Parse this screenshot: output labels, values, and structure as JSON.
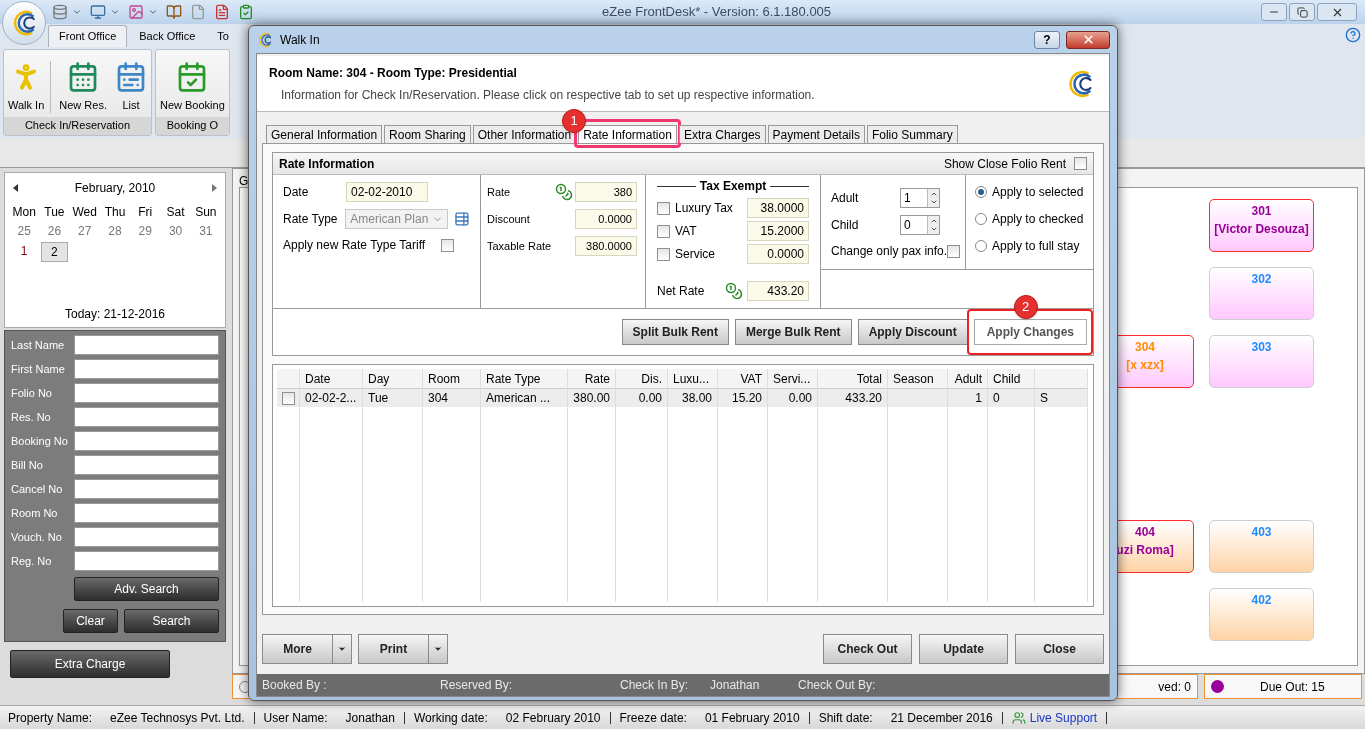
{
  "app": {
    "title": "eZee FrontDesk* - Version: 6.1.180.005"
  },
  "ribbon_tabs": [
    {
      "label": "Front Office",
      "selected": true
    },
    {
      "label": "Back Office",
      "selected": false
    },
    {
      "label": "To",
      "selected": false
    }
  ],
  "ribbon_groups": [
    {
      "label": "Check In/Reservation",
      "buttons": [
        {
          "label": "Walk In",
          "kind": "walkin"
        },
        {
          "label": "New Res.",
          "kind": "calendar"
        },
        {
          "label": "List",
          "kind": "list"
        }
      ]
    },
    {
      "label": "Booking O",
      "buttons": [
        {
          "label": "New Booking",
          "kind": "booking"
        }
      ]
    }
  ],
  "calendar": {
    "month": "February, 2010",
    "weekdays": [
      "Mon",
      "Tue",
      "Wed",
      "Thu",
      "Fri",
      "Sat",
      "Sun"
    ],
    "days": [
      {
        "label": "25",
        "muted": true,
        "selected": false
      },
      {
        "label": "26",
        "muted": true,
        "selected": false
      },
      {
        "label": "27",
        "muted": true,
        "selected": false
      },
      {
        "label": "28",
        "muted": true,
        "selected": false
      },
      {
        "label": "29",
        "muted": true,
        "selected": false
      },
      {
        "label": "30",
        "muted": true,
        "selected": false
      },
      {
        "label": "31",
        "muted": true,
        "selected": false
      },
      {
        "label": "1",
        "muted": false,
        "selected": false
      },
      {
        "label": "2",
        "muted": false,
        "selected": true
      }
    ],
    "today": "Today: 21-12-2016"
  },
  "search": {
    "fields": [
      "Last Name",
      "First Name",
      "Folio No",
      "Res. No",
      "Booking No",
      "Bill No",
      "Cancel No",
      "Room No",
      "Vouch. No",
      "Reg. No"
    ],
    "advanced": "Adv. Search",
    "clear": "Clear",
    "submit": "Search"
  },
  "extra_charge": "Extra Charge",
  "main_tab": "G",
  "room_columns": [
    {
      "floors": [
        {
          "rooms": [
            {
              "number": "304",
              "guest": "[x xzx]",
              "kind": "arrival"
            }
          ]
        },
        {
          "rooms": [
            {
              "number": "404",
              "guest": "uzi Roma]",
              "kind": "occupied"
            }
          ]
        }
      ]
    },
    {
      "floors": [
        {
          "rooms": [
            {
              "number": "301",
              "guest": "[Victor Desouza]",
              "kind": "occupied"
            },
            {
              "number": "302",
              "kind": "vacant"
            },
            {
              "number": "303",
              "kind": "vacant"
            }
          ]
        },
        {
          "rooms": [
            {
              "number": "403",
              "kind": "vacant"
            },
            {
              "number": "402",
              "kind": "vacant"
            }
          ]
        }
      ]
    }
  ],
  "legend": [
    {
      "label": "ved: 0"
    },
    {
      "label": "Due Out: 15",
      "color": "#990099"
    }
  ],
  "status_bar": {
    "items": [
      {
        "label": "Property Name:",
        "value": "eZee Technosys Pvt. Ltd."
      },
      {
        "label": "User Name:",
        "value": "Jonathan"
      },
      {
        "label": "Working date:",
        "value": "02 February 2010"
      },
      {
        "label": "Freeze date:",
        "value": "01 February 2010"
      },
      {
        "label": "Shift date:",
        "value": "21 December 2016"
      }
    ],
    "support": "Live Support"
  },
  "dialog": {
    "title": "Walk In",
    "help": "?",
    "room_heading": "Room Name: 304 - Room Type: Presidential",
    "hint": "Information for Check In/Reservation. Please click on respective tab to set up respective information.",
    "tabs": [
      {
        "label": "General Information",
        "selected": false
      },
      {
        "label": "Room Sharing",
        "selected": false
      },
      {
        "label": "Other Information",
        "selected": false
      },
      {
        "label": "Rate Information",
        "selected": true,
        "callout": "1"
      },
      {
        "label": "Extra Charges",
        "selected": false
      },
      {
        "label": "Payment Details",
        "selected": false
      },
      {
        "label": "Folio Summary",
        "selected": false
      }
    ],
    "section_title": "Rate Information",
    "show_close_folio": {
      "label": "Show Close Folio Rent",
      "checked": false
    },
    "date": {
      "label": "Date",
      "value": "02-02-2010"
    },
    "rate_type": {
      "label": "Rate Type",
      "value": "American Plan",
      "disabled": true
    },
    "apply_tariff": {
      "label": "Apply new Rate Type Tariff",
      "checked": false
    },
    "amounts": [
      {
        "label": "Rate",
        "value": "380",
        "kind": "currency"
      },
      {
        "label": "Discount",
        "value": "0.0000",
        "kind": "plain"
      },
      {
        "label": "Taxable Rate",
        "value": "380.0000",
        "kind": "plain"
      }
    ],
    "tax_exempt": {
      "title": "Tax Exempt",
      "taxes": [
        {
          "label": "Luxury Tax",
          "value": "38.0000",
          "checked": false
        },
        {
          "label": "VAT",
          "value": "15.2000",
          "checked": false
        },
        {
          "label": "Service",
          "value": "0.0000",
          "checked": false
        }
      ],
      "net_rate": {
        "label": "Net Rate",
        "value": "433.20"
      }
    },
    "pax": [
      {
        "label": "Adult",
        "value": "1"
      },
      {
        "label": "Child",
        "value": "0"
      }
    ],
    "pax_only": {
      "label": "Change only pax info.",
      "checked": false
    },
    "apply_options": [
      {
        "label": "Apply to selected",
        "selected": true
      },
      {
        "label": "Apply to checked",
        "selected": false
      },
      {
        "label": "Apply to full stay",
        "selected": false
      }
    ],
    "actions": [
      {
        "label": "Split Bulk Rent",
        "kind": "normal"
      },
      {
        "label": "Merge Bulk Rent",
        "kind": "normal"
      },
      {
        "label": "Apply Discount",
        "kind": "normal"
      },
      {
        "label": "Apply Changes",
        "kind": "focused",
        "callout": "2"
      }
    ],
    "grid": {
      "columns": [
        "Date",
        "Day",
        "Room",
        "Rate Type",
        "Rate",
        "Dis.",
        "Luxu...",
        "VAT",
        "Servi...",
        "Total",
        "Season",
        "Adult",
        "Child"
      ],
      "rows": [
        {
          "checked": false,
          "cells": [
            "02-02-2...",
            "Tue",
            "304",
            "American ...",
            "380.00",
            "0.00",
            "38.00",
            "15.20",
            "0.00",
            "433.20",
            null,
            "1",
            "0",
            "S"
          ]
        }
      ]
    },
    "footer_buttons": [
      {
        "label": "More",
        "kind": "split"
      },
      {
        "label": "Print",
        "kind": "split"
      },
      {
        "label": "Check Out",
        "kind": "plain"
      },
      {
        "label": "Update",
        "kind": "plain"
      },
      {
        "label": "Close",
        "kind": "plain"
      }
    ],
    "footer_info": [
      {
        "label": "Booked By :"
      },
      {
        "label": "Reserved By:"
      },
      {
        "label": "Check In By:",
        "value": "Jonathan"
      },
      {
        "label": "Check Out By:"
      }
    ]
  }
}
